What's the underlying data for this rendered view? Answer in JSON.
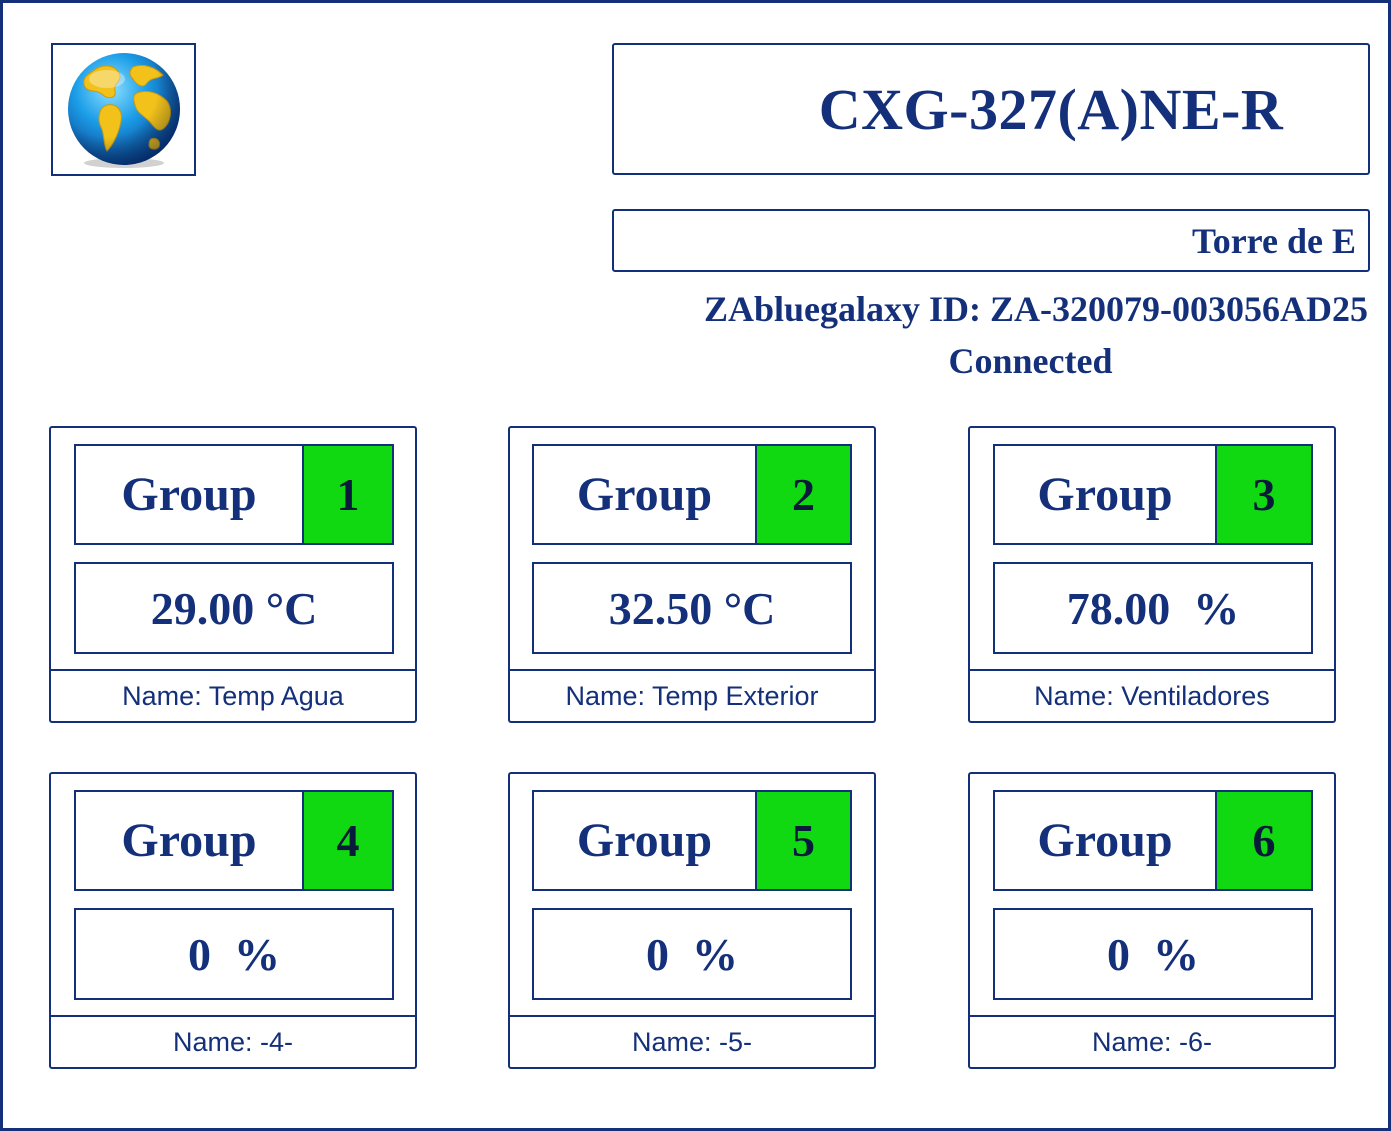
{
  "header": {
    "logo_icon": "globe-icon",
    "device_model": "CXG-327(A)NE-R",
    "location": "Torre de E",
    "device_id": "ZAbluegalaxy ID: ZA-320079-003056AD25",
    "status": "Connected"
  },
  "colors": {
    "primary": "#14307a",
    "group_badge": "#11d911",
    "background": "#ffffff"
  },
  "groups": [
    {
      "label": "Group",
      "number": "1",
      "value": "29.00 °C",
      "name": "Name: Temp Agua"
    },
    {
      "label": "Group",
      "number": "2",
      "value": "32.50 °C",
      "name": "Name: Temp Exterior"
    },
    {
      "label": "Group",
      "number": "3",
      "value": "78.00  %",
      "name": "Name: Ventiladores"
    },
    {
      "label": "Group",
      "number": "4",
      "value": "0  %",
      "name": "Name: -4-"
    },
    {
      "label": "Group",
      "number": "5",
      "value": "0  %",
      "name": "Name: -5-"
    },
    {
      "label": "Group",
      "number": "6",
      "value": "0  %",
      "name": "Name: -6-"
    }
  ]
}
